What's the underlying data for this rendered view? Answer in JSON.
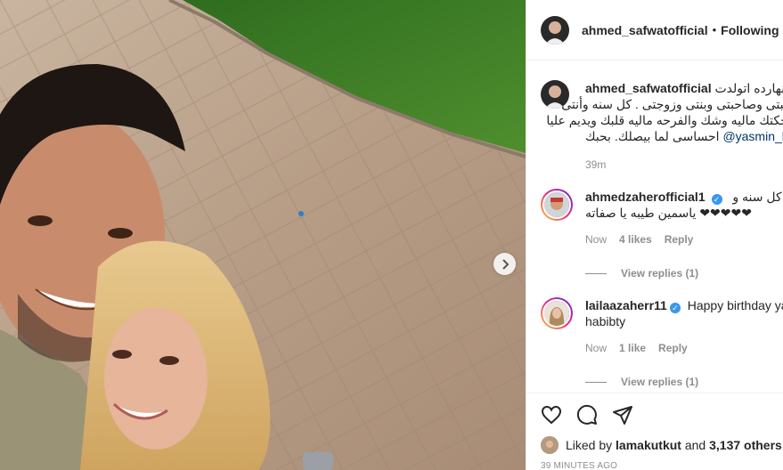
{
  "post": {
    "author": "ahmed_safwatofficial",
    "follow_status": "Following",
    "separator": "•",
    "caption_lines": [
      "زى انهارده اتولدت",
      "حبيبتى وصاحبتى وبنتى وزوجتى . كل سنه وأنتى",
      "ضحكتك ماليه وشك والفرحه ماليه قلبك ويديم عليا",
      "احساسى لما بيصلك. بحبك"
    ],
    "caption_mention": "@yasmin_hendawy",
    "caption_time": "39m"
  },
  "comments": [
    {
      "username": "ahmedzaherofficial1",
      "verified": true,
      "lines": [
        "كل سنه و",
        "❤❤❤❤❤ ياسمين طيبه يا صفاته"
      ],
      "time": "Now",
      "likes": "4 likes",
      "reply": "Reply",
      "view_replies": "View replies (1)"
    },
    {
      "username": "lailaazaherr11",
      "verified": true,
      "text": "Happy birthday ya habibty",
      "trailing_glyphs": "",
      "time": "Now",
      "likes": "1 like",
      "reply": "Reply",
      "view_replies": "View replies (1)"
    }
  ],
  "footer": {
    "liked_by_prefix": "Liked by",
    "liked_by_user": "lamakutkut",
    "and": "and",
    "others": "3,137 others",
    "timestamp": "39 MINUTES AGO"
  },
  "icons": {
    "like": "heart-icon",
    "comment": "comment-icon",
    "share": "paper-plane-icon",
    "next": "chevron-right-icon",
    "verified": "verified-badge-icon"
  },
  "colors": {
    "verified": "#3897f0",
    "mention": "#00376b",
    "muted": "#8e8e8e",
    "text": "#262626"
  }
}
